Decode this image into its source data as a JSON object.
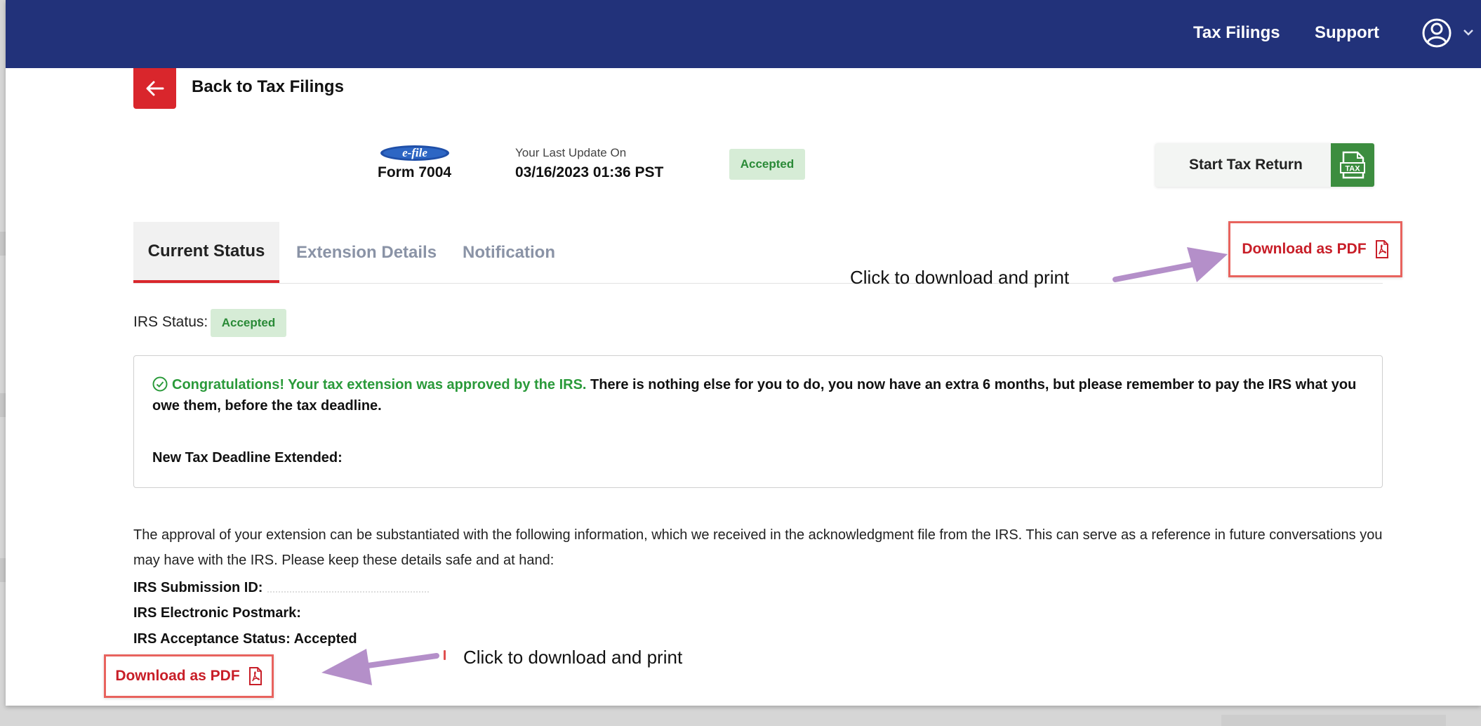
{
  "nav": {
    "tax_filings": "Tax Filings",
    "support": "Support"
  },
  "header": {
    "back_label": "Back to Tax Filings",
    "efile_logo_text": "e-file",
    "form_name": "Form 7004",
    "last_update_label": "Your Last Update On",
    "last_update_value": "03/16/2023 01:36 PST",
    "status_badge": "Accepted",
    "start_return_label": "Start Tax Return",
    "start_return_icon_text": "TAX"
  },
  "tabs": [
    {
      "label": "Current Status",
      "active": true
    },
    {
      "label": "Extension Details",
      "active": false
    },
    {
      "label": "Notification",
      "active": false
    }
  ],
  "download_pdf_label": "Download as PDF",
  "annotations": {
    "top": "Click to download and print",
    "bottom": "Click to download and print"
  },
  "irs_status": {
    "label": "IRS Status:",
    "value": "Accepted"
  },
  "notice": {
    "green_text": "Congratulations! Your tax extension was approved by the IRS.",
    "body_text": " There is nothing else for you to do, you now have an extra 6 months, but please remember to pay the IRS what you owe them, before the tax deadline.",
    "deadline_label": "New Tax Deadline Extended:"
  },
  "approval_text": "The approval of your extension can be substantiated with the following information, which we received in the acknowledgment file from the IRS. This can serve as a reference in future conversations you may have with the IRS. Please keep these details safe and at hand:",
  "details": {
    "submission_id_label": "IRS Submission ID:",
    "postmark_label": "IRS Electronic Postmark:",
    "acceptance_label": "IRS Acceptance Status: Accepted"
  },
  "colors": {
    "topbar": "#22327a",
    "brand_red": "#d9262c",
    "accepted_green": "#2a8a37",
    "annotation_arrow": "#b48fc9"
  }
}
